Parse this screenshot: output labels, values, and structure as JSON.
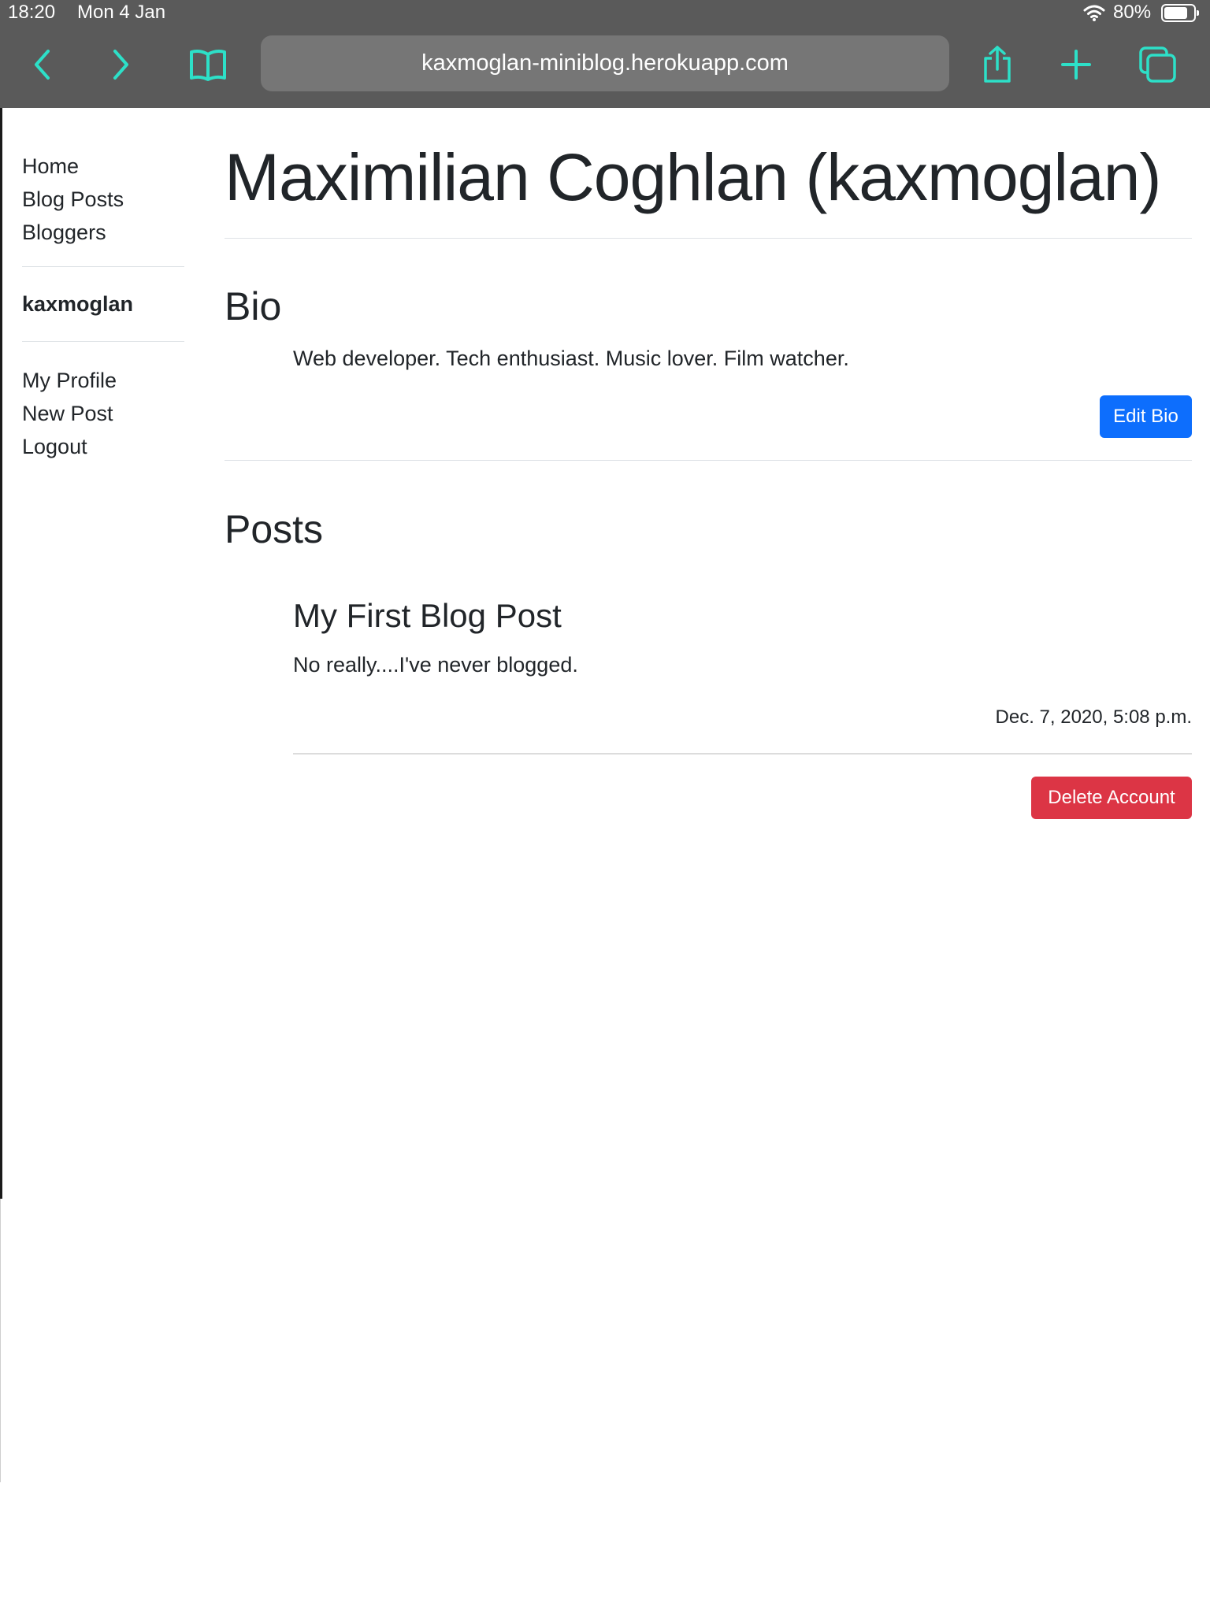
{
  "status_bar": {
    "time": "18:20",
    "date": "Mon 4 Jan",
    "battery_percent_label": "80%",
    "battery_level": 0.8,
    "icons": [
      "wifi-icon",
      "battery-icon"
    ]
  },
  "toolbar": {
    "url": "kaxmoglan-miniblog.herokuapp.com",
    "accent_color": "#2de0c8",
    "icons": [
      "back-icon",
      "forward-icon",
      "bookmarks-icon",
      "share-icon",
      "new-tab-icon",
      "tabs-icon"
    ]
  },
  "sidebar": {
    "nav_links": [
      {
        "label": "Home"
      },
      {
        "label": "Blog Posts"
      },
      {
        "label": "Bloggers"
      }
    ],
    "username": "kaxmoglan",
    "user_links": [
      {
        "label": "My Profile"
      },
      {
        "label": "New Post"
      },
      {
        "label": "Logout"
      }
    ]
  },
  "profile": {
    "title": "Maximilian Coghlan (kaxmoglan)",
    "bio_heading": "Bio",
    "bio_text": "Web developer. Tech enthusiast. Music lover. Film watcher.",
    "edit_bio_label": "Edit Bio",
    "posts_heading": "Posts",
    "posts": [
      {
        "title": "My First Blog Post",
        "body": "No really....I've never blogged.",
        "date": "Dec. 7, 2020, 5:08 p.m."
      }
    ],
    "delete_account_label": "Delete Account"
  },
  "colors": {
    "primary": "#0d6efd",
    "danger": "#dc3545",
    "chrome": "#5a5a5a",
    "text": "#212529"
  }
}
